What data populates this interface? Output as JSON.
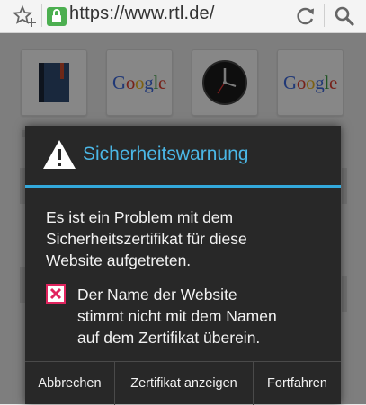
{
  "browser": {
    "url": "https://www.rtl.de/"
  },
  "speed_dial": {
    "tiles": [
      {
        "icon": "notebook-icon"
      },
      {
        "icon": "google-logo",
        "label": "Google"
      },
      {
        "icon": "clock-icon"
      },
      {
        "icon": "google-logo",
        "label": "Google"
      }
    ]
  },
  "dialog": {
    "title": "Sicherheitswarnung",
    "message_lines": [
      "Es ist ein Problem mit dem",
      "Sicherheitszertifikat für diese",
      "Website aufgetreten."
    ],
    "error_lines": [
      "Der Name der Website",
      "stimmt nicht mit dem Namen",
      "auf dem Zertifikat überein."
    ],
    "buttons": {
      "cancel": "Abbrechen",
      "view_certificate": "Zertifikat anzeigen",
      "continue": "Fortfahren"
    }
  },
  "colors": {
    "title_blue": "#4bb7e6",
    "divider_blue": "#33a9dc",
    "error_red": "#e0245e",
    "secure_green": "#4caf50"
  }
}
